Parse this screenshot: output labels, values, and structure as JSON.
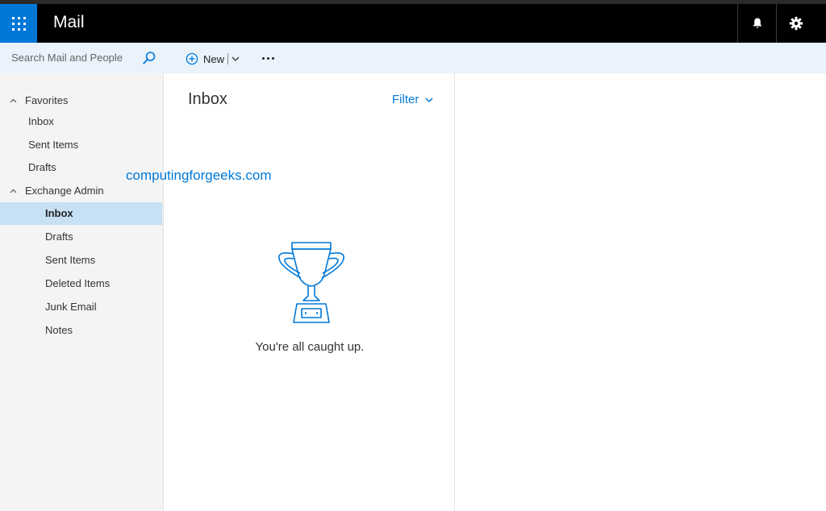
{
  "header": {
    "app_title": "Mail"
  },
  "command_bar": {
    "search_placeholder": "Search Mail and People",
    "new_label": "New"
  },
  "sidebar": {
    "favorites_label": "Favorites",
    "favorites": [
      "Inbox",
      "Sent Items",
      "Drafts"
    ],
    "account_label": "Exchange Admin",
    "folders": [
      "Inbox",
      "Drafts",
      "Sent Items",
      "Deleted Items",
      "Junk Email",
      "Notes"
    ],
    "selected_folder": "Inbox"
  },
  "list_pane": {
    "title": "Inbox",
    "filter_label": "Filter",
    "empty_message": "You're all caught up."
  },
  "watermark": "computingforgeeks.com",
  "colors": {
    "accent": "#0078d7",
    "header_bg": "#000000",
    "command_bar_bg": "#eaf3fb",
    "sidebar_bg": "#f4f4f4",
    "selected_bg": "#c7e0f4"
  },
  "icons": [
    "app-launcher-icon",
    "bell-icon",
    "gear-icon",
    "search-icon",
    "plus-circle-icon",
    "chevron-down-icon",
    "more-icon",
    "caret-up-icon",
    "trophy-icon"
  ]
}
